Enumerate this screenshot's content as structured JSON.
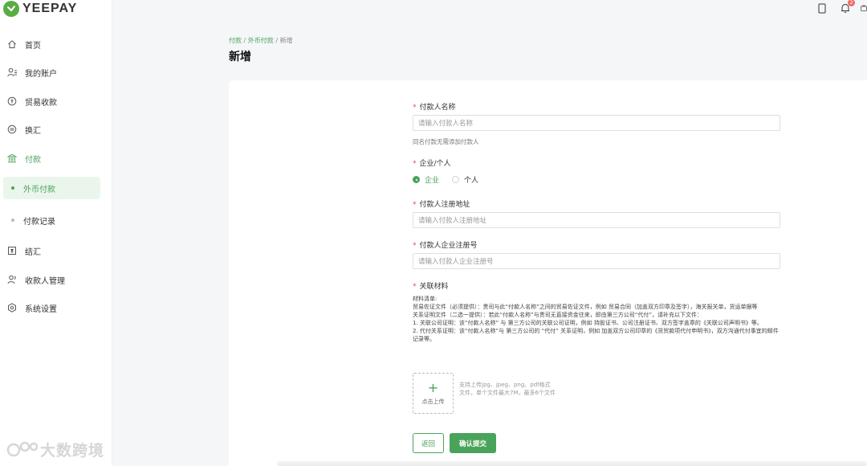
{
  "brand": {
    "name": "YEEPAY",
    "color": "#4aa35a"
  },
  "sidebar": {
    "items": [
      {
        "label": "首页",
        "icon": "home-icon"
      },
      {
        "label": "我的账户",
        "icon": "user-list-icon"
      },
      {
        "label": "贸易收款",
        "icon": "trade-collect-icon"
      },
      {
        "label": "换汇",
        "icon": "exchange-icon"
      },
      {
        "label": "付款",
        "icon": "bank-icon"
      },
      {
        "label": "外币付款",
        "icon": "dot-icon"
      },
      {
        "label": "付款记录",
        "icon": "dot-icon"
      },
      {
        "label": "结汇",
        "icon": "settlement-icon"
      },
      {
        "label": "收款人管理",
        "icon": "payee-icon"
      },
      {
        "label": "系统设置",
        "icon": "gear-icon"
      }
    ]
  },
  "watermark": {
    "text": "大数跨境"
  },
  "topbar": {
    "notification_count": "2"
  },
  "breadcrumb": {
    "item1": "付款",
    "sep1": " / ",
    "item2": "外币付款",
    "sep2": " / ",
    "item3": "新增"
  },
  "page": {
    "title": "新增"
  },
  "form": {
    "payer_name": {
      "label": "付款人名称",
      "placeholder": "请输入付款人名称",
      "hint": "同名付款无需添加付款人"
    },
    "entity_type": {
      "label": "企业/个人",
      "options": [
        "企业",
        "个人"
      ],
      "selected": "企业"
    },
    "reg_address": {
      "label": "付款人注册地址",
      "placeholder": "请输入付款人注册地址"
    },
    "reg_number": {
      "label": "付款人企业注册号",
      "placeholder": "请输入付款人企业注册号"
    },
    "materials": {
      "label": "关联材料",
      "lines": [
        "材料清单:",
        "贸易佐证文件（必须提供）：贵司与此“付款人名称”之间的贸易佐证文件，例如 贸易合同（加盖双方印章及签字），海关报关单，货运单据等",
        "关系证明文件（二选一提供）：若此“付款人名称”与贵司无直接资金往来，即由第三方公司“代付”，请补充以下文件：",
        "1. 关联公司证明：该“付款人名称” 与 第三方公司的关联公司证明，例如 持股证书、公司注册证书、双方签字盖章的《关联公司声明书》等。",
        "2. 代付关系证明：该“付款人名称”与 第三方公司的 “代付” 关系证明，例如 加盖双方公司印章的《货贸款项代付申明书》，双方沟通代付事宜的邮件记录等。"
      ],
      "upload_label": "点击上传",
      "upload_note": "支持上传jpg、jpeg、png、pdf格式文件，单个文件最大7M，最多6个文件"
    },
    "buttons": {
      "back": "返回",
      "submit": "确认提交"
    }
  }
}
